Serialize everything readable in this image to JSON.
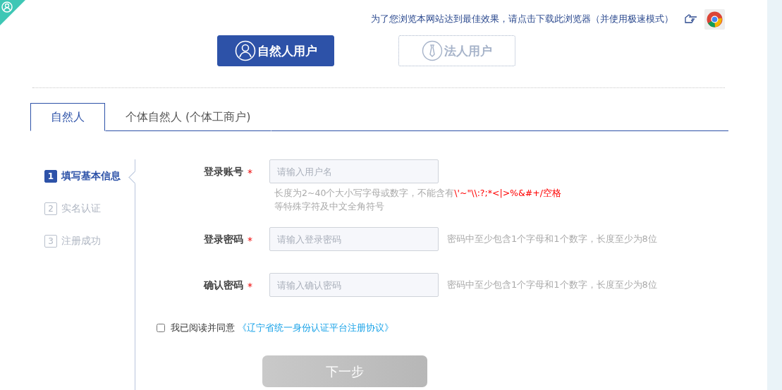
{
  "notice": {
    "text": "为了您浏览本网站达到最佳效果，请点击下载此浏览器（并使用极速模式）"
  },
  "user_types": [
    {
      "label": "自然人用户",
      "kind": "person",
      "selected": true
    },
    {
      "label": "法人用户",
      "kind": "tie",
      "selected": false
    }
  ],
  "tabs": [
    {
      "label": "自然人",
      "selected": true
    },
    {
      "label": "个体自然人 (个体工商户)",
      "selected": false
    }
  ],
  "steps": [
    {
      "number": "1",
      "label": "填写基本信息",
      "selected": true
    },
    {
      "number": "2",
      "label": "实名认证",
      "selected": false
    },
    {
      "number": "3",
      "label": "注册成功",
      "selected": false
    }
  ],
  "fields": [
    {
      "label": "登录账号",
      "required_mark": "*",
      "placeholder": "请输入用户名",
      "hint": {
        "kind": "below",
        "text": "长度为2~40个大小写字母或数字，不能含有",
        "special": "\\'~\"\\\\:?;*<|>%&#+/空格",
        "continuation": "等特殊字符及中文全角符号"
      }
    },
    {
      "label": "登录密码",
      "required_mark": "*",
      "placeholder": "请输入登录密码",
      "hint": {
        "kind": "side",
        "text": "密码中至少包含1个字母和1个数字，长度至少为8位"
      }
    },
    {
      "label": "确认密码",
      "required_mark": "*",
      "placeholder": "请输入确认密码",
      "hint": {
        "kind": "side",
        "text": "密码中至少包含1个字母和1个数字，长度至少为8位"
      }
    }
  ],
  "agreement": {
    "checked": false,
    "text": "我已阅读并同意",
    "link": "《辽宁省统一身份认证平台注册协议》"
  },
  "next_button": {
    "label": "下一步",
    "disabled": true
  }
}
